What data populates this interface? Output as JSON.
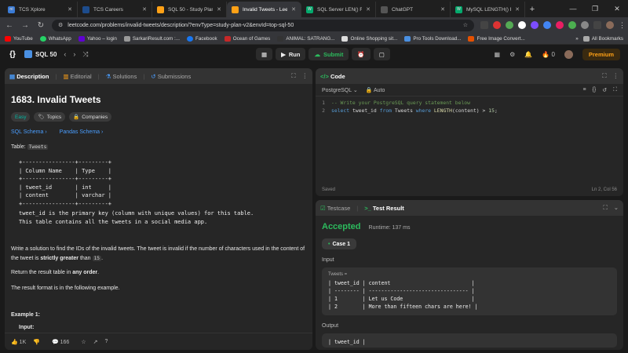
{
  "browser": {
    "tabs": [
      {
        "title": "TCS Xplore",
        "color": "#3a7bd5",
        "letter": "ni"
      },
      {
        "title": "TCS Careers",
        "color": "#1d4c8c",
        "letter": ""
      },
      {
        "title": "SQL 50 - Study Plan",
        "color": "#ffa116",
        "letter": ""
      },
      {
        "title": "Invalid Tweets - Leetc",
        "color": "#ffa116",
        "letter": ""
      },
      {
        "title": "SQL Server LEN() Fun",
        "color": "#04aa6d",
        "letter": "W"
      },
      {
        "title": "ChatGPT",
        "color": "#555555",
        "letter": ""
      },
      {
        "title": "MySQL LENGTH() Fun",
        "color": "#04aa6d",
        "letter": "W"
      }
    ],
    "url": "leetcode.com/problems/invalid-tweets/description/?envType=study-plan-v2&envId=top-sql-50",
    "bookmarks": [
      "YouTube",
      "WhatsApp",
      "Yahoo – login",
      "SarkariResult.com :...",
      "Facebook",
      "Ocean of Games",
      "ANIMAL: SATRANG...",
      "Online Shopping sit...",
      "Pro Tools Download...",
      "Free Image Convert..."
    ],
    "bookmarks_right": "All Bookmarks"
  },
  "leetcode": {
    "title": "SQL 50",
    "run_label": "Run",
    "submit_label": "Submit",
    "fire_count": "0",
    "premium_label": "Premium"
  },
  "problem": {
    "tabs": [
      "Description",
      "Editorial",
      "Solutions",
      "Submissions"
    ],
    "title": "1683. Invalid Tweets",
    "difficulty": "Easy",
    "topics_label": "Topics",
    "companies_label": "Companies",
    "schema_links": [
      "SQL Schema",
      "Pandas Schema"
    ],
    "table_label": "Table:",
    "table_name": "Tweets",
    "schema_table": "+----------------+---------+\n| Column Name    | Type    |\n+----------------+---------+\n| tweet_id       | int     |\n| content        | varchar |\n+----------------+---------+",
    "schema_note": "tweet_id is the primary key (column with unique values) for this table.\nThis table contains all the tweets in a social media app.",
    "desc1_a": "Write a solution to find the IDs of the invalid tweets. The tweet is invalid if the number of characters used in the content of the tweet is ",
    "desc1_b": "strictly greater",
    "desc1_c": " than ",
    "desc1_code": "15",
    "desc2_a": "Return the result table in ",
    "desc2_b": "any order",
    "desc3": "The result format is in the following example.",
    "example_title": "Example 1:",
    "input_label": "Input:",
    "likes": "1K",
    "comments": "166"
  },
  "editor": {
    "header": "Code",
    "language": "PostgreSQL",
    "auto": "Auto",
    "lines": [
      "-- Write your PostgreSQL query statement below",
      "select tweet_id from Tweets where LENGTH(content) > 15;"
    ],
    "status_left": "Saved",
    "status_right": "Ln 2, Col 56"
  },
  "result": {
    "tabs": [
      "Testcase",
      "Test Result"
    ],
    "verdict": "Accepted",
    "runtime": "Runtime: 137 ms",
    "case_label": "Case 1",
    "input_label": "Input",
    "input_table_name": "Tweets =",
    "input_table": "| tweet_id | content                          |\n| -------- | -------------------------------- |\n| 1        | Let us Code                      |\n| 2        | More than fifteen chars are here! |",
    "output_label": "Output",
    "output_table": "| tweet_id |"
  }
}
